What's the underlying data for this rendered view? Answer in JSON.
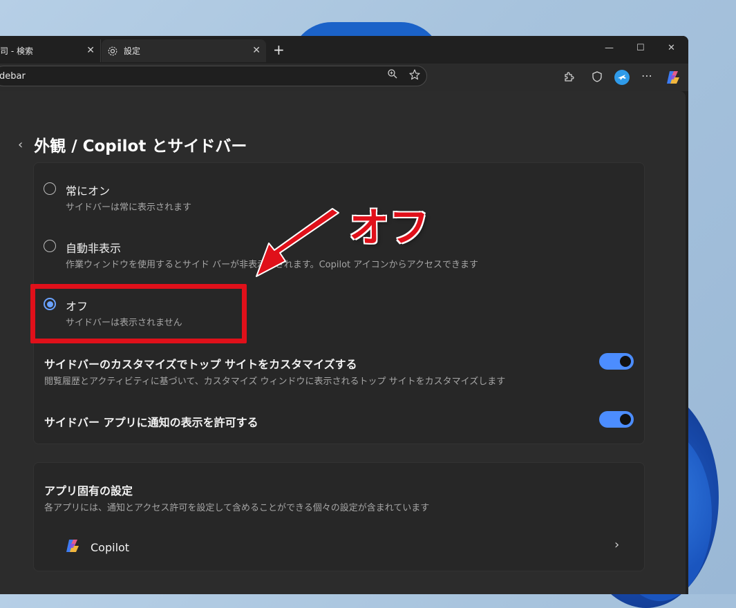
{
  "tabs": [
    {
      "label": "司 - 検索",
      "close": "✕"
    },
    {
      "label": "設定",
      "close": "✕"
    }
  ],
  "new_tab": "+",
  "window_controls": {
    "minimize": "—",
    "maximize": "☐",
    "close": "✕"
  },
  "address": {
    "value": "debar"
  },
  "page": {
    "back": "‹",
    "title": "外観 / Copilot とサイドバー"
  },
  "sidebar_options": [
    {
      "label": "常にオン",
      "desc": "サイドバーは常に表示されます",
      "selected": false
    },
    {
      "label": "自動非表示",
      "desc": "作業ウィンドウを使用するとサイド バーが非表示にされます。Copilot アイコンからアクセスできます",
      "selected": false
    },
    {
      "label": "オフ",
      "desc": "サイドバーは表示されません",
      "selected": true
    }
  ],
  "settings": [
    {
      "label": "サイドバーのカスタマイズでトップ サイトをカスタマイズする",
      "desc": "閲覧履歴とアクティビティに基づいて、カスタマイズ ウィンドウに表示されるトップ サイトをカスタマイズします",
      "enabled": true
    },
    {
      "label": "サイドバー アプリに通知の表示を許可する",
      "enabled": true
    }
  ],
  "app_settings": {
    "title": "アプリ固有の設定",
    "desc": "各アプリには、通知とアクセス許可を設定して含めることができる個々の設定が含まれています",
    "apps": [
      {
        "name": "Copilot",
        "chevron": "›"
      }
    ]
  },
  "annotation": {
    "label": "オフ",
    "color": "#e0101a"
  },
  "colors": {
    "accent": "#4c8dff",
    "radio_selected": "#6aa2ff",
    "background": "#2c2c2c"
  }
}
